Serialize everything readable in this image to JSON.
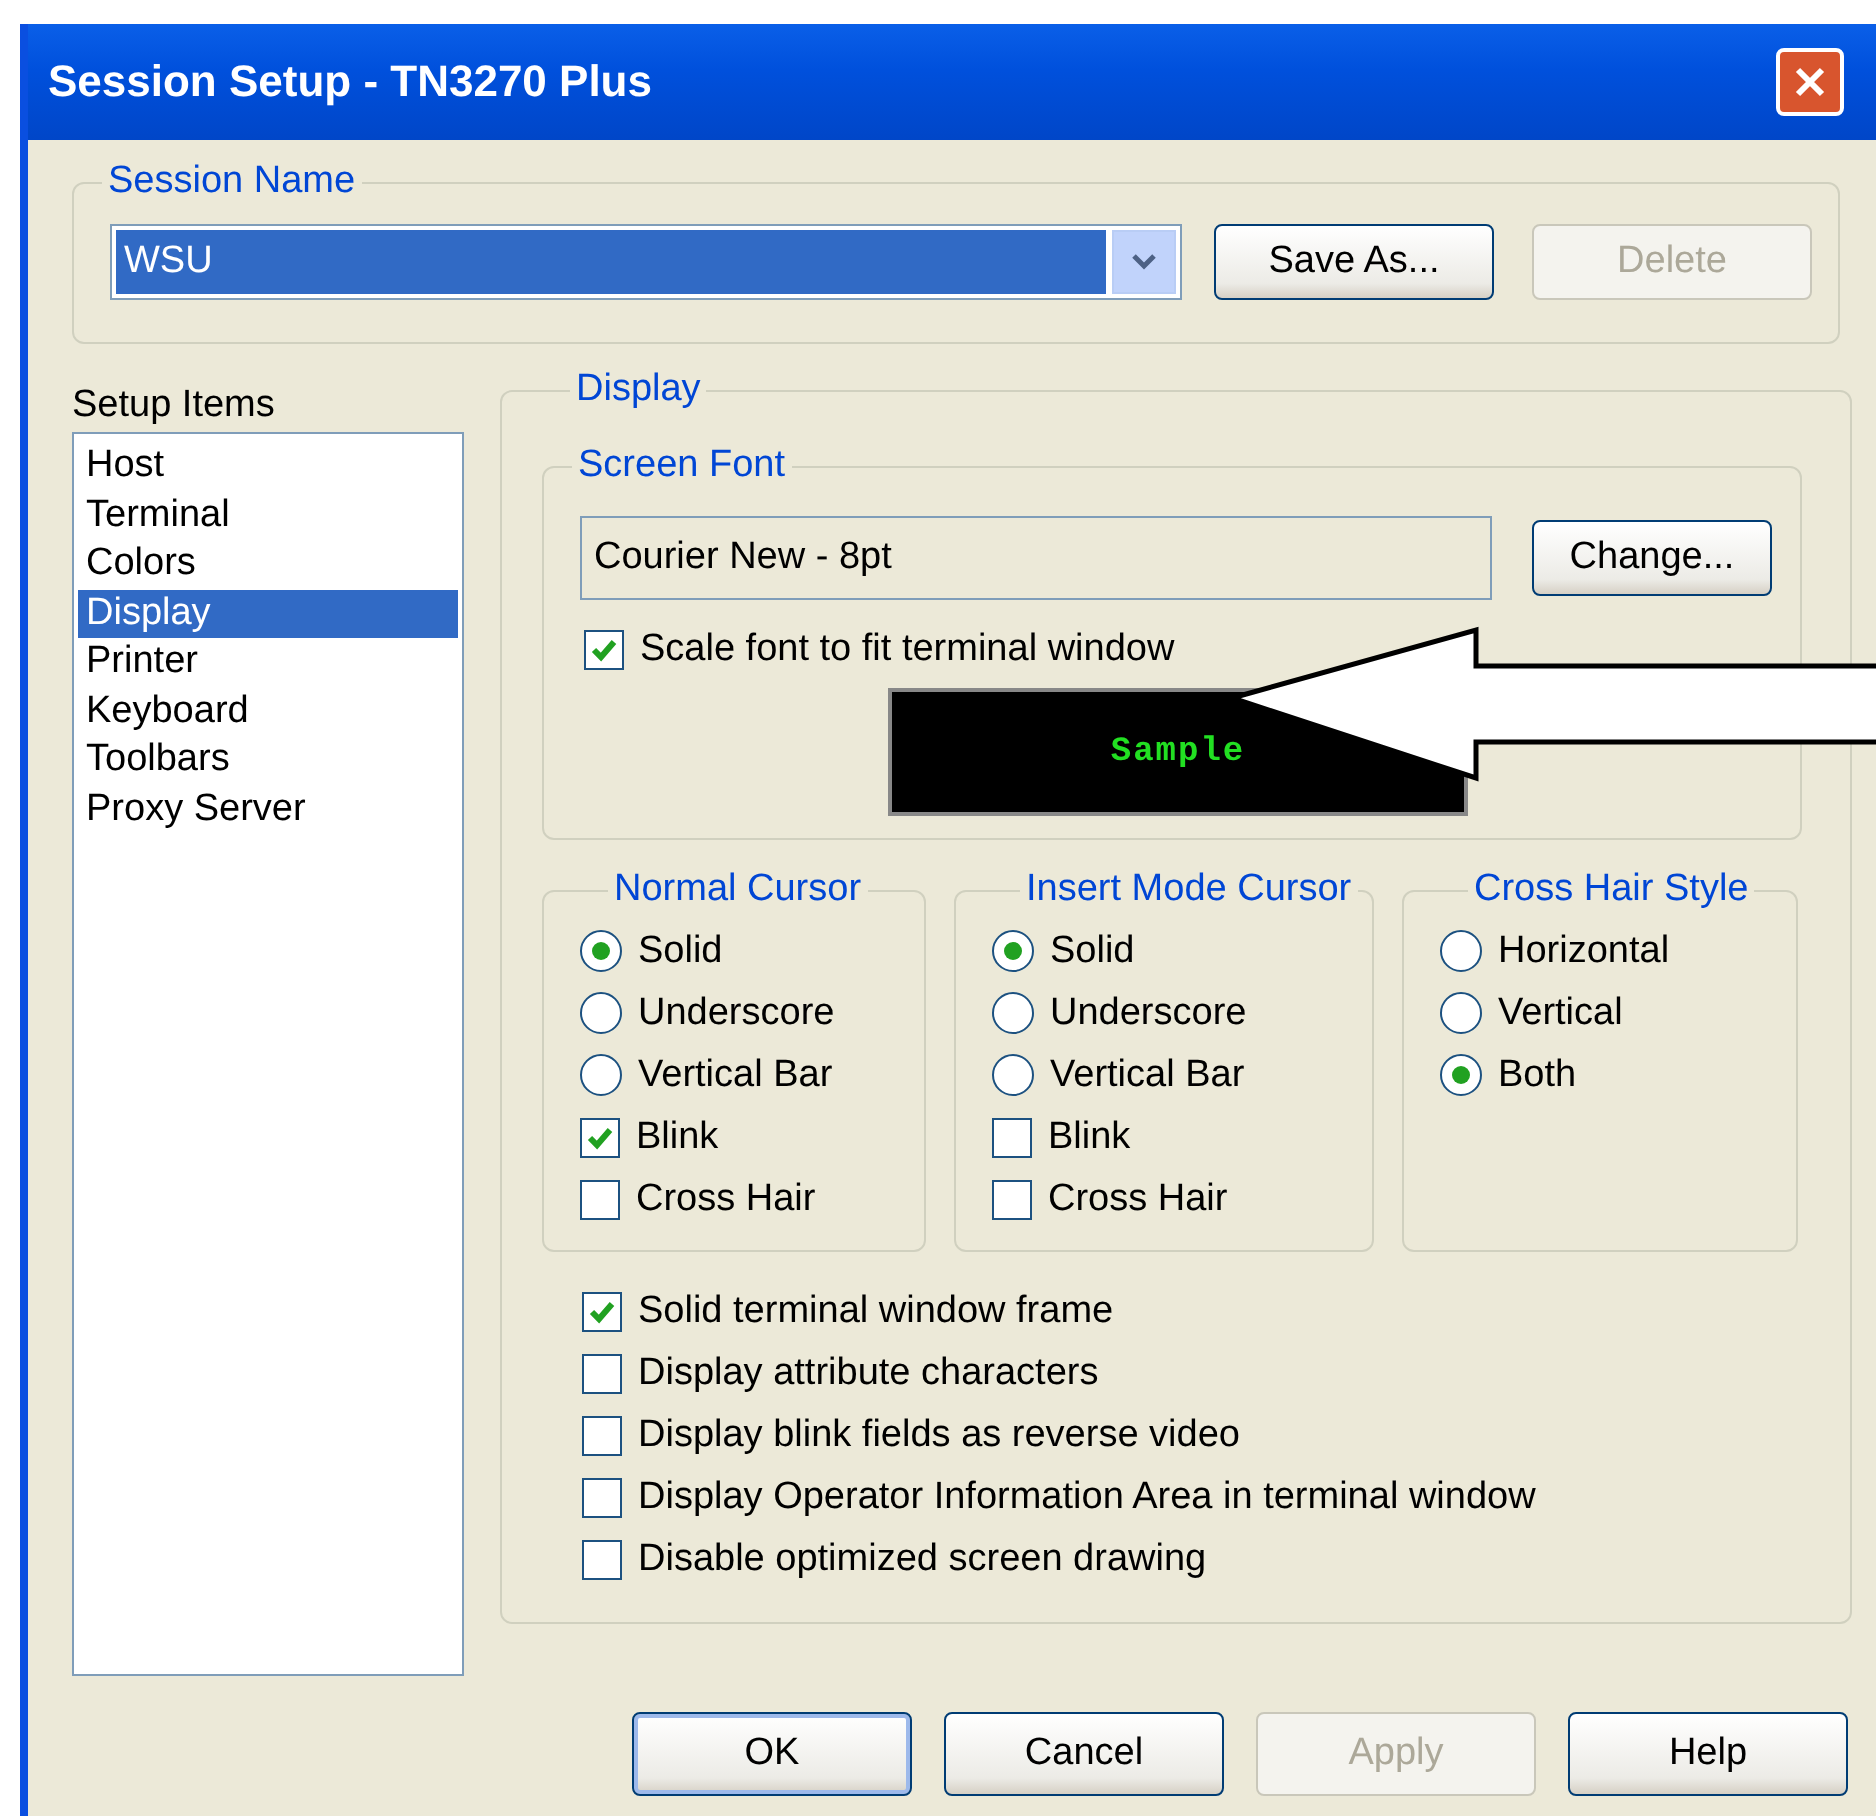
{
  "window": {
    "title": "Session Setup - TN3270 Plus"
  },
  "session_name": {
    "legend": "Session Name",
    "value": "WSU",
    "buttons": [
      {
        "label": "Save As...",
        "disabled": false
      },
      {
        "label": "Delete",
        "disabled": true
      }
    ]
  },
  "setup_items": {
    "label": "Setup Items",
    "items": [
      {
        "label": "Host",
        "selected": false
      },
      {
        "label": "Terminal",
        "selected": false
      },
      {
        "label": "Colors",
        "selected": false
      },
      {
        "label": "Display",
        "selected": true
      },
      {
        "label": "Printer",
        "selected": false
      },
      {
        "label": "Keyboard",
        "selected": false
      },
      {
        "label": "Toolbars",
        "selected": false
      },
      {
        "label": "Proxy Server",
        "selected": false
      }
    ]
  },
  "display": {
    "legend": "Display",
    "screen_font": {
      "legend": "Screen Font",
      "value": "Courier New - 8pt",
      "change_button": "Change...",
      "scale": {
        "label": "Scale font to fit terminal window",
        "checked": true
      },
      "sample": "Sample"
    },
    "groups": [
      {
        "legend": "Normal Cursor",
        "options": [
          {
            "kind": "radio",
            "label": "Solid",
            "selected": true
          },
          {
            "kind": "radio",
            "label": "Underscore",
            "selected": false
          },
          {
            "kind": "radio",
            "label": "Vertical Bar",
            "selected": false
          },
          {
            "kind": "checkbox",
            "label": "Blink",
            "checked": true
          },
          {
            "kind": "checkbox",
            "label": "Cross Hair",
            "checked": false
          }
        ]
      },
      {
        "legend": "Insert Mode Cursor",
        "options": [
          {
            "kind": "radio",
            "label": "Solid",
            "selected": true
          },
          {
            "kind": "radio",
            "label": "Underscore",
            "selected": false
          },
          {
            "kind": "radio",
            "label": "Vertical Bar",
            "selected": false
          },
          {
            "kind": "checkbox",
            "label": "Blink",
            "checked": false
          },
          {
            "kind": "checkbox",
            "label": "Cross Hair",
            "checked": false
          }
        ]
      },
      {
        "legend": "Cross Hair Style",
        "options": [
          {
            "kind": "radio",
            "label": "Horizontal",
            "selected": false
          },
          {
            "kind": "radio",
            "label": "Vertical",
            "selected": false
          },
          {
            "kind": "radio",
            "label": "Both",
            "selected": true
          }
        ]
      }
    ],
    "checkboxes": [
      {
        "label": "Solid terminal window frame",
        "checked": true
      },
      {
        "label": "Display attribute characters",
        "checked": false
      },
      {
        "label": "Display blink fields as reverse video",
        "checked": false
      },
      {
        "label": "Display Operator Information Area in terminal window",
        "checked": false
      },
      {
        "label": "Disable optimized screen drawing",
        "checked": false
      }
    ]
  },
  "footer_buttons": [
    {
      "label": "OK",
      "disabled": false
    },
    {
      "label": "Cancel",
      "disabled": false
    },
    {
      "label": "Apply",
      "disabled": true
    },
    {
      "label": "Help",
      "disabled": false
    }
  ]
}
